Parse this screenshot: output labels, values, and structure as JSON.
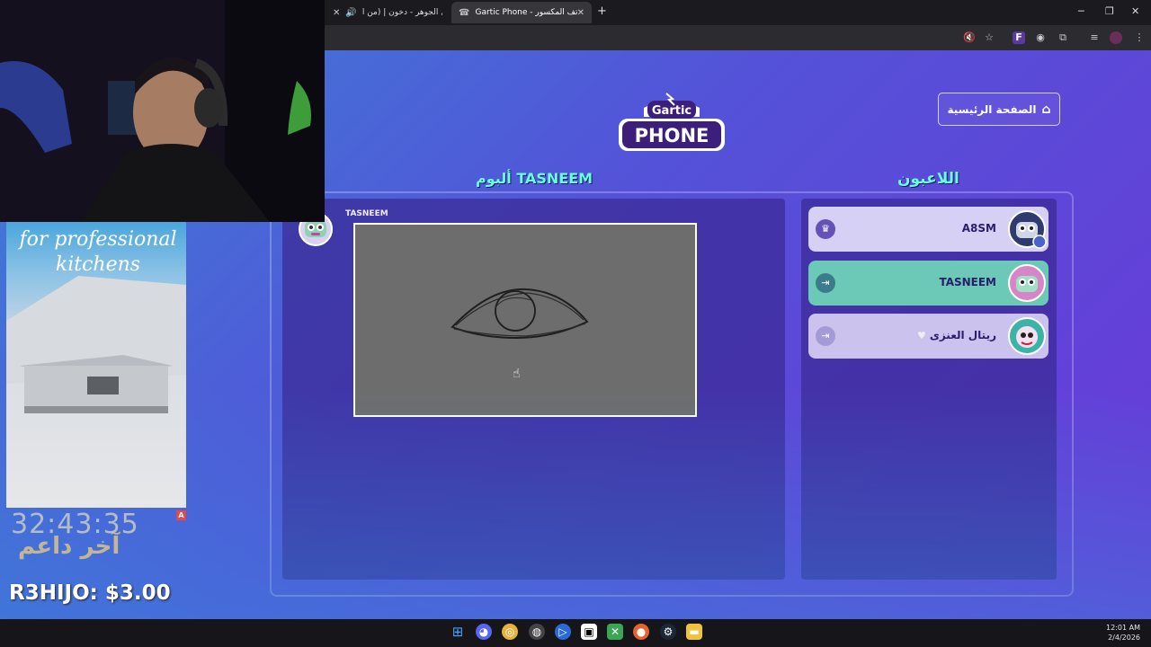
{
  "browser": {
    "tabs": [
      {
        "label": "عبادي الجوهر - دخون | (من أ..."
      },
      {
        "label": "Gartic Phone - الهاتف المكسور"
      }
    ],
    "new_tab": "+",
    "close_glyph": "✕"
  },
  "page": {
    "home_button": "الصفحة الرئيسية",
    "logo_top": "Gartic",
    "logo_bottom": "PHONE",
    "album_title": "ألبوم TASNEEM",
    "players_title": "اللاعبون",
    "drawer_name": "TASNEEM",
    "players": [
      {
        "name": "A8SM",
        "icon": "crown-icon"
      },
      {
        "name": "TASNEEM",
        "icon": "enter-icon"
      },
      {
        "name": "ريتال العنزى",
        "icon": "enter-icon",
        "badge": "heart-icon"
      }
    ]
  },
  "stream_overlay": {
    "ad_text": "for professional kitchens",
    "timer": "32:43:35",
    "last_supporter_label": "آخر داعم",
    "donation": "R3HIJO: $3.00",
    "ad_badge": "A"
  },
  "taskbar": {
    "time": "12:01 AM",
    "date": "2/4/2026"
  }
}
